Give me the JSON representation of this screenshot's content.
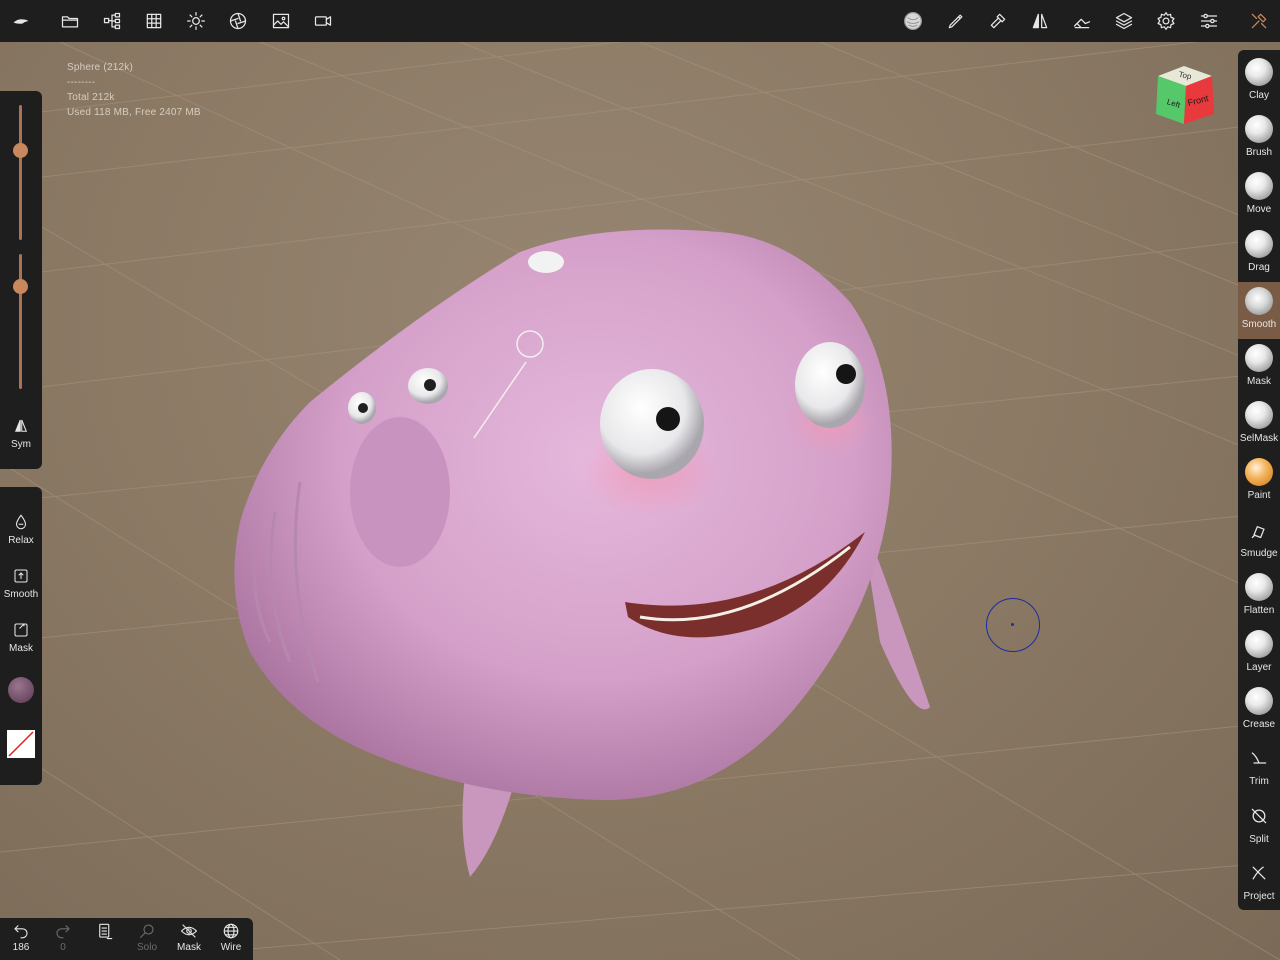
{
  "topbar": {
    "left_icons": [
      "app-logo-icon",
      "folder-icon",
      "scene-tree-icon",
      "grid-icon",
      "light-icon",
      "material-icon",
      "image-icon",
      "camera-icon"
    ],
    "right_icons": [
      "brush-preview-icon",
      "stroke-icon",
      "hammer-icon",
      "symmetry-icon",
      "painting-icon",
      "layers-icon",
      "settings-icon",
      "sliders-icon",
      "tools-icon"
    ]
  },
  "stats": {
    "mesh": "Sphere (212k)",
    "separator": "--------",
    "total": "Total 212k",
    "memory": "Used 118 MB,  Free 2407 MB"
  },
  "left_panel": {
    "sym_label": "Sym",
    "relax_label": "Relax",
    "smooth_label": "Smooth",
    "mask_label": "Mask",
    "radius_level": 0.67,
    "intensity_level": 0.76
  },
  "viewcube": {
    "top": "Top",
    "left": "Left",
    "front": "Front"
  },
  "tools": [
    {
      "label": "Clay",
      "kind": "ball"
    },
    {
      "label": "Brush",
      "kind": "ball"
    },
    {
      "label": "Move",
      "kind": "ball"
    },
    {
      "label": "Drag",
      "kind": "ball"
    },
    {
      "label": "Smooth",
      "kind": "smooth",
      "active": true
    },
    {
      "label": "Mask",
      "kind": "ball"
    },
    {
      "label": "SelMask",
      "kind": "ball"
    },
    {
      "label": "Paint",
      "kind": "paint"
    },
    {
      "label": "Smudge",
      "kind": "glyph"
    },
    {
      "label": "Flatten",
      "kind": "ball"
    },
    {
      "label": "Layer",
      "kind": "ball"
    },
    {
      "label": "Crease",
      "kind": "ball"
    },
    {
      "label": "Trim",
      "kind": "glyph"
    },
    {
      "label": "Split",
      "kind": "glyph"
    },
    {
      "label": "Project",
      "kind": "glyph"
    }
  ],
  "bottombar": {
    "undo_count": "186",
    "redo_count": "0",
    "solo_label": "Solo",
    "mask_label": "Mask",
    "wire_label": "Wire"
  },
  "colors": {
    "accent": "#c9875d",
    "panel": "#1e1e1e",
    "active_tool": "#7a5b45",
    "model": "#d9a6cf",
    "background": "#8b7862"
  }
}
